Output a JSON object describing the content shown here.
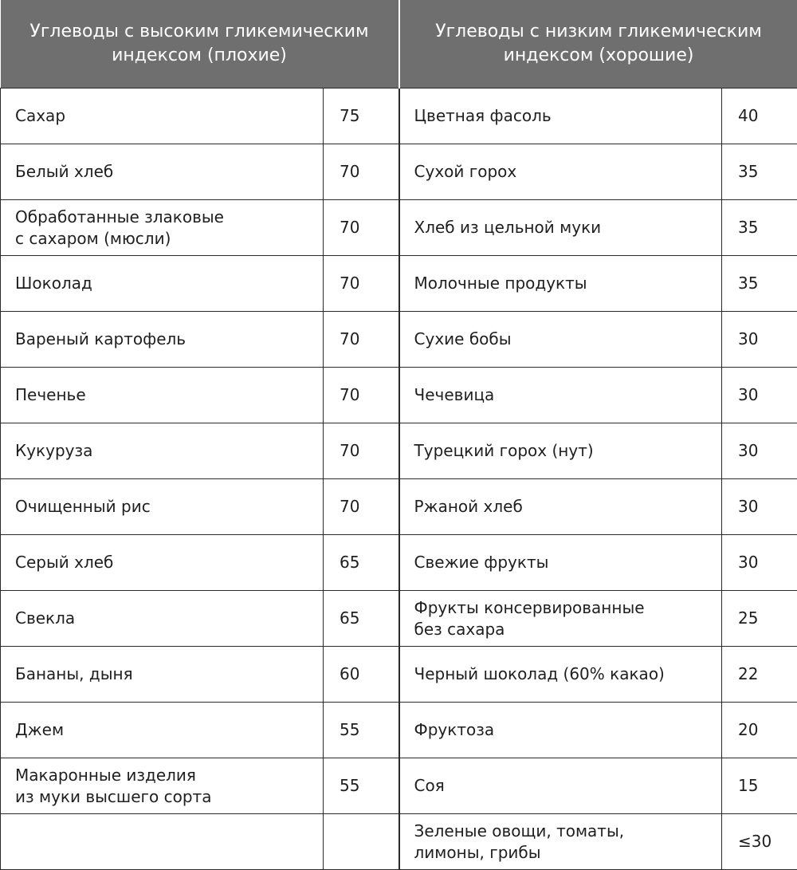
{
  "headers": {
    "high": [
      "Углеводы с высоким гликемическим",
      "индексом (плохие)"
    ],
    "low": [
      "Углеводы с низким гликемическим",
      "индексом (хорошие)"
    ]
  },
  "rows": [
    {
      "high_name": [
        "Сахар"
      ],
      "high_value": "75",
      "low_name": [
        "Цветная фасоль"
      ],
      "low_value": "40"
    },
    {
      "high_name": [
        "Белый хлеб"
      ],
      "high_value": "70",
      "low_name": [
        "Сухой горох"
      ],
      "low_value": "35"
    },
    {
      "high_name": [
        "Обработанные злаковые",
        "с сахаром (мюсли)"
      ],
      "high_value": "70",
      "low_name": [
        "Хлеб из цельной муки"
      ],
      "low_value": "35"
    },
    {
      "high_name": [
        "Шоколад"
      ],
      "high_value": "70",
      "low_name": [
        "Молочные продукты"
      ],
      "low_value": "35"
    },
    {
      "high_name": [
        "Вареный картофель"
      ],
      "high_value": "70",
      "low_name": [
        "Сухие бобы"
      ],
      "low_value": "30"
    },
    {
      "high_name": [
        "Печенье"
      ],
      "high_value": "70",
      "low_name": [
        "Чечевица"
      ],
      "low_value": "30"
    },
    {
      "high_name": [
        "Кукуруза"
      ],
      "high_value": "70",
      "low_name": [
        "Турецкий горох (нут)"
      ],
      "low_value": "30"
    },
    {
      "high_name": [
        "Очищенный рис"
      ],
      "high_value": "70",
      "low_name": [
        "Ржаной хлеб"
      ],
      "low_value": "30"
    },
    {
      "high_name": [
        "Серый хлеб"
      ],
      "high_value": "65",
      "low_name": [
        "Свежие фрукты"
      ],
      "low_value": "30"
    },
    {
      "high_name": [
        "Свекла"
      ],
      "high_value": "65",
      "low_name": [
        "Фрукты консервированные",
        "без сахара"
      ],
      "low_value": "25"
    },
    {
      "high_name": [
        "Бананы, дыня"
      ],
      "high_value": "60",
      "low_name": [
        "Черный шоколад (60% какао)"
      ],
      "low_value": "22"
    },
    {
      "high_name": [
        "Джем"
      ],
      "high_value": "55",
      "low_name": [
        "Фруктоза"
      ],
      "low_value": "20"
    },
    {
      "high_name": [
        "Макаронные изделия",
        "из муки высшего сорта"
      ],
      "high_value": "55",
      "low_name": [
        "Соя"
      ],
      "low_value": "15"
    },
    {
      "high_name": [],
      "high_value": "",
      "low_name": [
        "Зеленые овощи, томаты,",
        "лимоны, грибы"
      ],
      "low_value": "≤30"
    }
  ]
}
